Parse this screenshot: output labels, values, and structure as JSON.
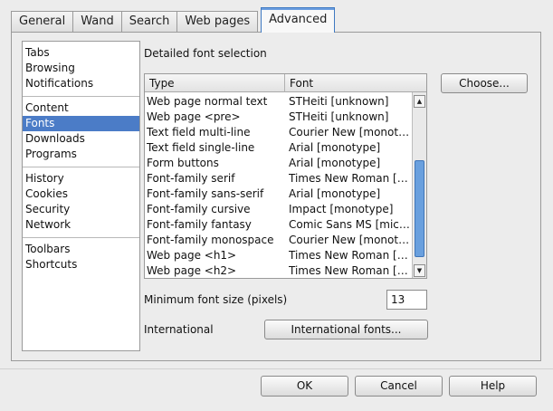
{
  "tabs": [
    "General",
    "Wand",
    "Search",
    "Web pages",
    "Advanced"
  ],
  "active_tab": "Advanced",
  "sidebar": {
    "groups": [
      [
        "Tabs",
        "Browsing",
        "Notifications"
      ],
      [
        "Content",
        "Fonts",
        "Downloads",
        "Programs"
      ],
      [
        "History",
        "Cookies",
        "Security",
        "Network"
      ],
      [
        "Toolbars",
        "Shortcuts"
      ]
    ],
    "selected": "Fonts"
  },
  "fonts_panel": {
    "section_title": "Detailed font selection",
    "columns": {
      "type": "Type",
      "font": "Font"
    },
    "rows": [
      {
        "type": "Web page normal text",
        "font": "STHeiti [unknown]"
      },
      {
        "type": "Web page <pre>",
        "font": "STHeiti [unknown]"
      },
      {
        "type": "Text field multi-line",
        "font": "Courier New [monoty..."
      },
      {
        "type": "Text field single-line",
        "font": "Arial [monotype]"
      },
      {
        "type": "Form buttons",
        "font": "Arial [monotype]"
      },
      {
        "type": "Font-family serif",
        "font": "Times New Roman [m..."
      },
      {
        "type": "Font-family sans-serif",
        "font": "Arial [monotype]"
      },
      {
        "type": "Font-family cursive",
        "font": "Impact [monotype]"
      },
      {
        "type": "Font-family fantasy",
        "font": "Comic Sans MS [micro..."
      },
      {
        "type": "Font-family monospace",
        "font": "Courier New [monoty..."
      },
      {
        "type": "Web page <h1>",
        "font": "Times New Roman [m..."
      },
      {
        "type": "Web page <h2>",
        "font": "Times New Roman [m..."
      }
    ],
    "choose_button": "Choose...",
    "min_font_label": "Minimum font size (pixels)",
    "min_font_value": "13",
    "international_label": "International",
    "international_button": "International fonts..."
  },
  "footer": {
    "ok": "OK",
    "cancel": "Cancel",
    "help": "Help"
  },
  "icons": {
    "scroll_up": "scroll-up-arrow-icon",
    "scroll_down": "scroll-down-arrow-icon"
  },
  "colors": {
    "selection": "#4b7cc7",
    "scroll_thumb": "#6aa0de",
    "active_tab_accent": "#3e79c2"
  }
}
